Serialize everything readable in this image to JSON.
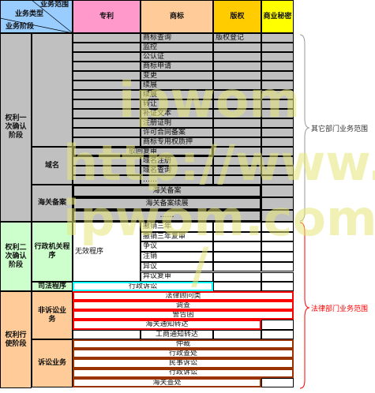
{
  "header": {
    "scope": "业务范围",
    "type": "业务类型",
    "stage": "业务阶段",
    "patent": "专利",
    "trademark": "商标",
    "copyright": "版权",
    "trade_secret": "商业秘密"
  },
  "stages": [
    "权利一次确认阶段",
    "权利二次确认阶段",
    "权利行使阶段"
  ],
  "types": [
    "域名",
    "海关备案",
    "行政机关程序",
    "司法程序",
    "非诉讼业务",
    "诉讼业务"
  ],
  "stage1": {
    "trademark_items": [
      "商标查询",
      "监控",
      "公认证",
      "商标申请",
      "变更",
      "续展",
      "续展",
      "转让",
      "补证文本",
      "注册证明",
      "许可合同备案",
      "商标专用权质押"
    ],
    "copyright_item": "版权登记",
    "review": "驳回复审",
    "domain_items": [
      "域名注册",
      "域名查询",
      "……"
    ],
    "customs_items": [
      "海关备案",
      "海关备案续展",
      "……"
    ]
  },
  "stage2": {
    "patent_item": "无效程序",
    "trademark_items": [
      "撤销三年",
      "撤销三年复审",
      "争议",
      "注销",
      "异议",
      "异议复审"
    ],
    "judicial": "行政诉讼"
  },
  "stage3": {
    "nonlit_items": [
      "法律顾问类",
      "调查",
      "警告函",
      "海关通知转达",
      "工商通知转达"
    ],
    "lit_items": [
      "仲裁",
      "行政查处",
      "民事诉讼",
      "行政诉讼",
      "海关查处"
    ]
  },
  "side_labels": {
    "other": "其它部门业务范围",
    "legal": "法律部门业务范围"
  },
  "watermark": [
    "ipwom",
    "http://www.",
    "ipwom.com",
    "/"
  ],
  "colors": {
    "header_bg": "#99ccff",
    "patent": "#ff99cc",
    "trademark": "#ffcc99",
    "copyright": "#ffcc00",
    "secret": "#ffff00",
    "gray": "#c0c0c0",
    "green": "#ccffcc",
    "peach": "#ffcc99",
    "legal": "#ff0000",
    "lit": "#993300",
    "cyan": "#00ffff"
  }
}
